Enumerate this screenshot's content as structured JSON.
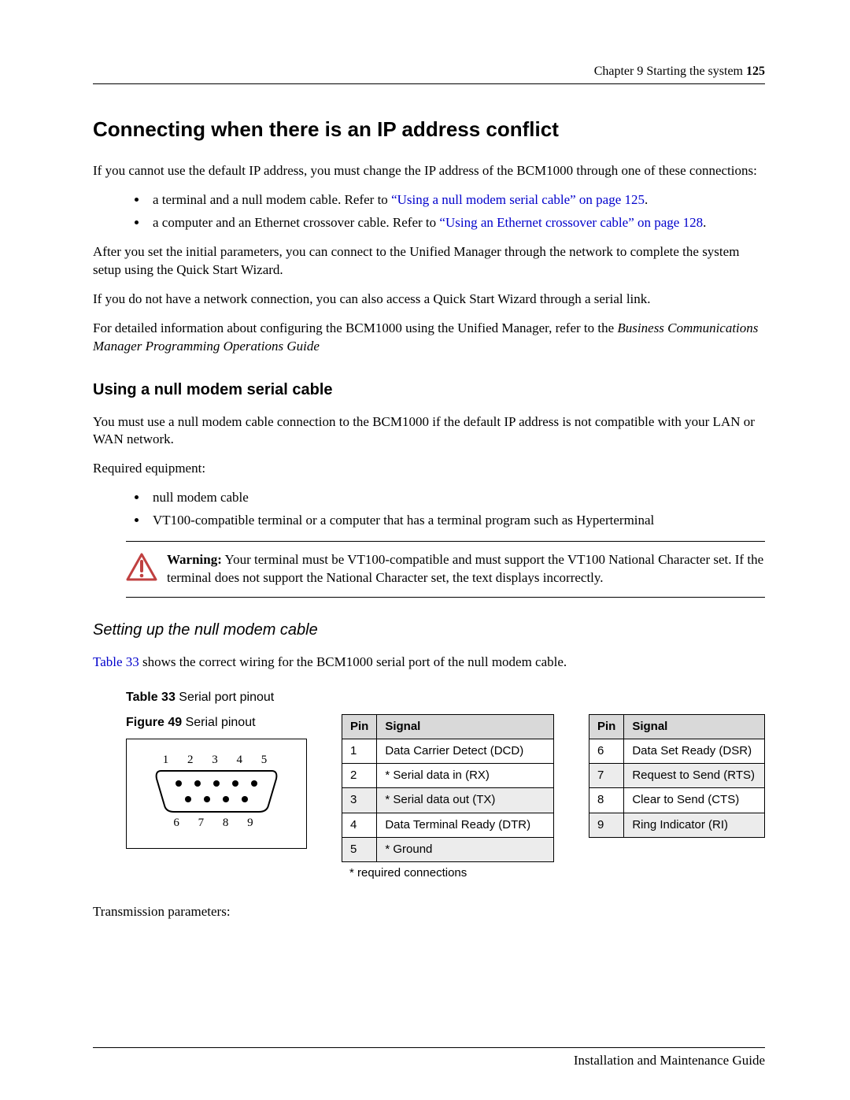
{
  "header": {
    "chapter": "Chapter 9 Starting the system",
    "page_number": "125"
  },
  "title": "Connecting when there is an IP address conflict",
  "intro": "If you cannot use the default IP address, you must change the IP address of the BCM1000 through one of these connections:",
  "bullets1": [
    {
      "prefix": "a terminal and a null modem cable. Refer to ",
      "link": "“Using a null modem serial cable” on page 125",
      "suffix": "."
    },
    {
      "prefix": "a computer and an Ethernet crossover cable. Refer to ",
      "link": "“Using an Ethernet crossover cable” on page 128",
      "suffix": "."
    }
  ],
  "para_after_bullets": "After you set the initial parameters, you can connect to the Unified Manager through the network to complete the system setup using the Quick Start Wizard.",
  "para_no_network": "If you do not have a network connection, you can also access a Quick Start Wizard through a serial link.",
  "para_detail_lead": "For detailed information about configuring the BCM1000 using the Unified Manager, refer to the",
  "para_detail_ref": "Business Communications Manager Programming Operations Guide",
  "sub1_title": "Using a null modem serial cable",
  "sub1_para": "You must use a null modem cable connection to the BCM1000 if the default IP address is not compatible with your LAN or WAN network.",
  "req_equip_label": "Required equipment:",
  "req_equip": [
    "null modem cable",
    "VT100-compatible terminal or a computer that has a terminal program such as Hyperterminal"
  ],
  "warning": {
    "label": "Warning:",
    "text": " Your terminal must be VT100-compatible and must support the VT100 National Character set. If the terminal does not support the National Character set, the text displays incorrectly."
  },
  "sub2_title": "Setting up the null modem cable",
  "sub2_para_pre": "",
  "sub2_link": "Table 33",
  "sub2_para_post": " shows the correct wiring for the BCM1000 serial port of the null modem cable.",
  "table_caption_bold": "Table 33",
  "table_caption_rest": "   Serial port pinout",
  "figure_caption_bold": "Figure 49",
  "figure_caption_rest": "   Serial pinout",
  "pin_header": {
    "pin": "Pin",
    "signal": "Signal"
  },
  "pins_left": [
    {
      "pin": "1",
      "signal": "Data Carrier Detect (DCD)",
      "shade": false
    },
    {
      "pin": "2",
      "signal": "* Serial data in (RX)",
      "shade": false
    },
    {
      "pin": "3",
      "signal": "* Serial data out (TX)",
      "shade": true
    },
    {
      "pin": "4",
      "signal": "Data Terminal Ready (DTR)",
      "shade": false
    },
    {
      "pin": "5",
      "signal": "* Ground",
      "shade": true
    }
  ],
  "pins_right": [
    {
      "pin": "6",
      "signal": "Data Set Ready (DSR)",
      "shade": false
    },
    {
      "pin": "7",
      "signal": "Request to Send (RTS)",
      "shade": true
    },
    {
      "pin": "8",
      "signal": "Clear to Send (CTS)",
      "shade": false
    },
    {
      "pin": "9",
      "signal": "Ring Indicator (RI)",
      "shade": true
    }
  ],
  "pin_footnote": "* required connections",
  "connector_top": "1  2  3  4  5",
  "connector_bottom": "6  7  8  9",
  "trans_params_label": "Transmission parameters:",
  "footer": "Installation and Maintenance Guide"
}
